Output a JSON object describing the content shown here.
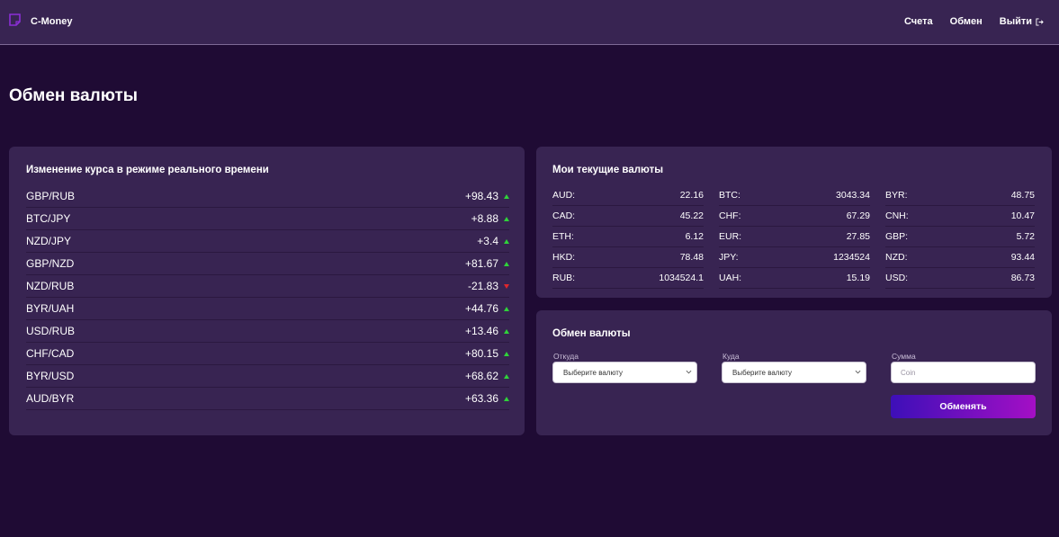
{
  "header": {
    "brand": "C-Money",
    "nav": [
      {
        "label": "Счета"
      },
      {
        "label": "Обмен"
      },
      {
        "label": "Выйти"
      }
    ]
  },
  "page": {
    "title": "Обмен валюты"
  },
  "rates": {
    "title": "Изменение курса в режиме реального времени",
    "items": [
      {
        "pair": "GBP/RUB",
        "change": "+98.43",
        "direction": "up"
      },
      {
        "pair": "BTC/JPY",
        "change": "+8.88",
        "direction": "up"
      },
      {
        "pair": "NZD/JPY",
        "change": "+3.4",
        "direction": "up"
      },
      {
        "pair": "GBP/NZD",
        "change": "+81.67",
        "direction": "up"
      },
      {
        "pair": "NZD/RUB",
        "change": "-21.83",
        "direction": "down"
      },
      {
        "pair": "BYR/UAH",
        "change": "+44.76",
        "direction": "up"
      },
      {
        "pair": "USD/RUB",
        "change": "+13.46",
        "direction": "up"
      },
      {
        "pair": "CHF/CAD",
        "change": "+80.15",
        "direction": "up"
      },
      {
        "pair": "BYR/USD",
        "change": "+68.62",
        "direction": "up"
      },
      {
        "pair": "AUD/BYR",
        "change": "+63.36",
        "direction": "up"
      }
    ],
    "colors": {
      "up": "#2fd33a",
      "down": "#e0262c"
    }
  },
  "balances": {
    "title": "Мои текущие валюты",
    "items": [
      {
        "code": "AUD:",
        "amount": "22.16"
      },
      {
        "code": "BTC:",
        "amount": "3043.34"
      },
      {
        "code": "BYR:",
        "amount": "48.75"
      },
      {
        "code": "CAD:",
        "amount": "45.22"
      },
      {
        "code": "CHF:",
        "amount": "67.29"
      },
      {
        "code": "CNH:",
        "amount": "10.47"
      },
      {
        "code": "ETH:",
        "amount": "6.12"
      },
      {
        "code": "EUR:",
        "amount": "27.85"
      },
      {
        "code": "GBP:",
        "amount": "5.72"
      },
      {
        "code": "HKD:",
        "amount": "78.48"
      },
      {
        "code": "JPY:",
        "amount": "1234524"
      },
      {
        "code": "NZD:",
        "amount": "93.44"
      },
      {
        "code": "RUB:",
        "amount": "1034524.1"
      },
      {
        "code": "UAH:",
        "amount": "15.19"
      },
      {
        "code": "USD:",
        "amount": "86.73"
      }
    ]
  },
  "exchange": {
    "title": "Обмен валюты",
    "from_label": "Откуда",
    "from_value": "Выберите валюту",
    "to_label": "Куда",
    "to_value": "Выберите валюту",
    "amount_label": "Сумма",
    "amount_placeholder": "Coin",
    "submit_label": "Обменять"
  },
  "icons": {
    "logo": "square-logo-icon",
    "logout": "logout-icon",
    "chevron": "chevron-down-icon"
  },
  "colors": {
    "background": "#1f0b34",
    "card": "#382452",
    "accent_start": "#3d0fb8",
    "accent_end": "#a40fc5",
    "logo": "#8b2fd6"
  }
}
